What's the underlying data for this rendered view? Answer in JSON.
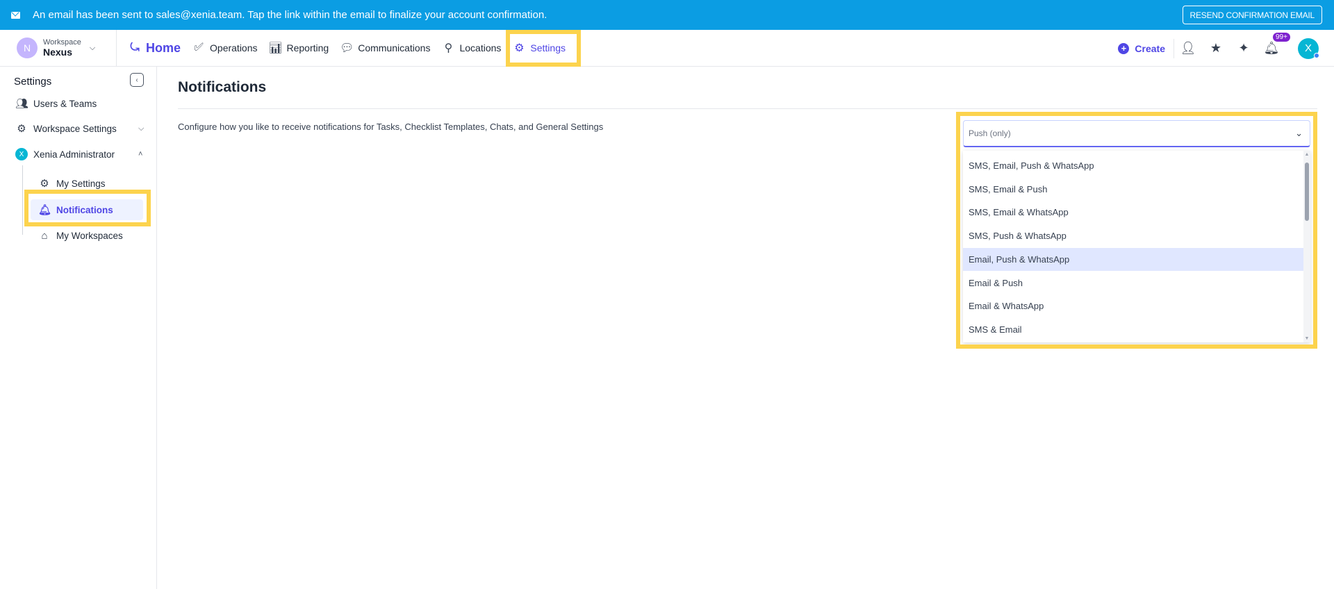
{
  "banner": {
    "message": "An email has been sent to sales@xenia.team. Tap the link within the email to finalize your account confirmation.",
    "resend_label": "RESEND CONFIRMATION EMAIL"
  },
  "workspace": {
    "initial": "N",
    "label": "Workspace",
    "name": "Nexus"
  },
  "nav": {
    "home": "Home",
    "operations": "Operations",
    "reporting": "Reporting",
    "communications": "Communications",
    "locations": "Locations",
    "settings": "Settings"
  },
  "rightnav": {
    "create": "Create",
    "notif_badge": "99+",
    "user_initial": "X"
  },
  "sidebar": {
    "title": "Settings",
    "users_teams": "Users & Teams",
    "workspace_settings": "Workspace Settings",
    "admin_initial": "X",
    "admin": "Xenia Administrator",
    "my_settings": "My Settings",
    "notifications": "Notifications",
    "my_workspaces": "My Workspaces"
  },
  "main": {
    "title": "Notifications",
    "description": "Configure how you like to receive notifications for Tasks, Checklist Templates, Chats, and General Settings"
  },
  "select": {
    "value": "Push (only)",
    "options": [
      "SMS, Email, Push & WhatsApp",
      "SMS, Email & Push",
      "SMS, Email & WhatsApp",
      "SMS, Push & WhatsApp",
      "Email, Push & WhatsApp",
      "Email & Push",
      "Email & WhatsApp",
      "SMS & Email"
    ],
    "hovered_index": 4
  },
  "colors": {
    "banner": "#0b9de3",
    "accent": "#4f46e5",
    "highlight": "#fcd34d"
  }
}
